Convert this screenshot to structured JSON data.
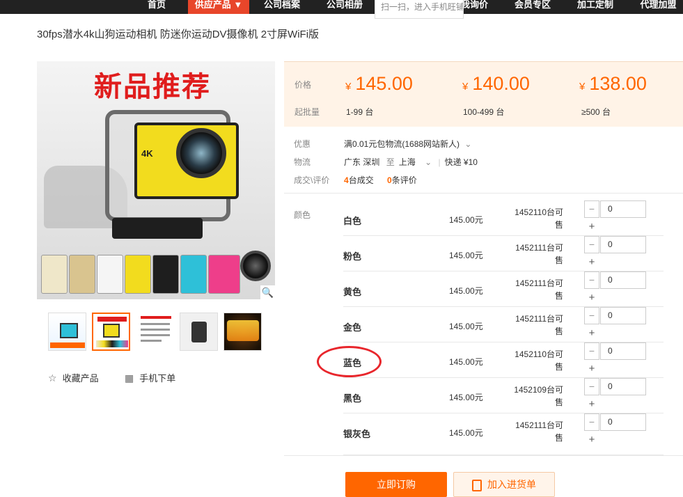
{
  "nav": {
    "items": [
      {
        "label": "首页"
      },
      {
        "label": "供应产品 ▼"
      },
      {
        "label": "公司档案"
      },
      {
        "label": "公司相册"
      },
      {
        "label": "我询价"
      },
      {
        "label": "会员专区"
      },
      {
        "label": "加工定制"
      },
      {
        "label": "代理加盟"
      }
    ],
    "search_text": "扫一扫，进入手机旺铺"
  },
  "product": {
    "title": "30fps潜水4k山狗运动相机 防迷你运动DV摄像机 2寸屏WiFi版",
    "image_headline": "新品推荐",
    "camera_mark": "4K"
  },
  "thumbs": [
    {
      "name": "thumb-1"
    },
    {
      "name": "thumb-2"
    },
    {
      "name": "thumb-3"
    },
    {
      "name": "thumb-4"
    },
    {
      "name": "thumb-5"
    }
  ],
  "actions": {
    "favorite": "收藏产品",
    "mobile_order": "手机下单",
    "buy_now": "立即订购",
    "add_to_list": "加入进货单"
  },
  "pricing": {
    "price_label": "价格",
    "moq_label": "起批量",
    "currency": "¥",
    "tiers": [
      {
        "price": "145.00",
        "qty": "1-99 台"
      },
      {
        "price": "140.00",
        "qty": "100-499 台"
      },
      {
        "price": "138.00",
        "qty": "≥500 台"
      }
    ]
  },
  "info": {
    "promo_label": "优惠",
    "promo_text": "满0.01元包物流(1688网站新人)",
    "shipping_label": "物流",
    "shipping_from": "广东 深圳",
    "shipping_to_word": "至",
    "shipping_to": "上海",
    "shipping_method": "快递 ¥10",
    "deals_label": "成交\\评价",
    "deals_count": "4",
    "deals_text": "台成交",
    "reviews_count": "0",
    "reviews_text": "条评价"
  },
  "sku": {
    "label": "颜色",
    "rows": [
      {
        "name": "白色",
        "price": "145.00元",
        "stock1": "1452110台可",
        "stock2": "售",
        "qty": "0"
      },
      {
        "name": "粉色",
        "price": "145.00元",
        "stock1": "1452111台可",
        "stock2": "售",
        "qty": "0"
      },
      {
        "name": "黄色",
        "price": "145.00元",
        "stock1": "1452111台可",
        "stock2": "售",
        "qty": "0"
      },
      {
        "name": "金色",
        "price": "145.00元",
        "stock1": "1452111台可",
        "stock2": "售",
        "qty": "0"
      },
      {
        "name": "蓝色",
        "price": "145.00元",
        "stock1": "1452110台可",
        "stock2": "售",
        "qty": "0"
      },
      {
        "name": "黑色",
        "price": "145.00元",
        "stock1": "1452109台可",
        "stock2": "售",
        "qty": "0"
      },
      {
        "name": "银灰色",
        "price": "145.00元",
        "stock1": "1452111台可",
        "stock2": "售",
        "qty": "0"
      }
    ]
  },
  "colors": {
    "accent": "#ff6600",
    "nav_bg": "#222222",
    "nav_active": "#e8462a",
    "price_band_bg": "#fff3e7",
    "annotation_red": "#e8262c"
  }
}
